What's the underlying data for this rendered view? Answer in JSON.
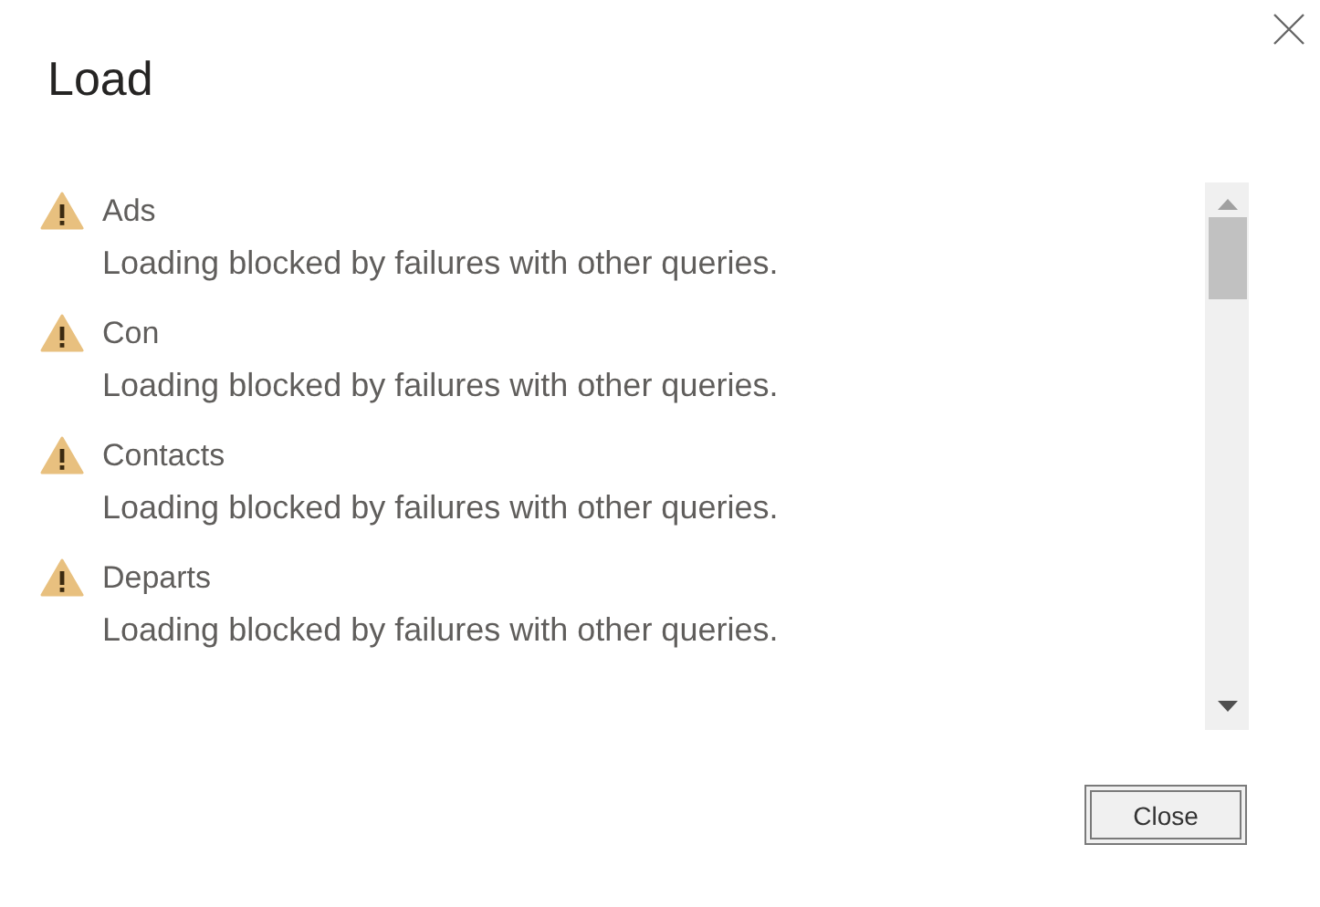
{
  "dialog": {
    "title": "Load"
  },
  "queries": [
    {
      "name": "Ads",
      "message": "Loading blocked by failures with other queries."
    },
    {
      "name": "Con",
      "message": "Loading blocked by failures with other queries."
    },
    {
      "name": "Contacts",
      "message": "Loading blocked by failures with other queries."
    },
    {
      "name": "Departs",
      "message": "Loading blocked by failures with other queries."
    }
  ],
  "buttons": [
    "Close"
  ]
}
